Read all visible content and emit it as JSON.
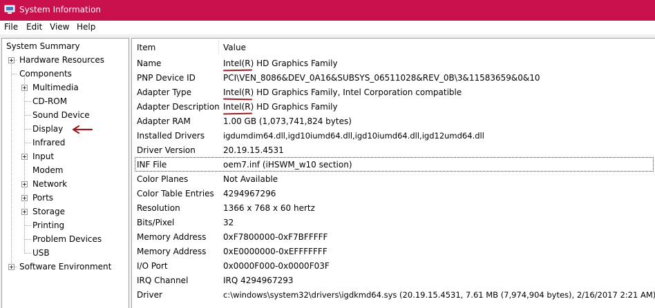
{
  "window": {
    "title": "System Information"
  },
  "menubar": {
    "items": [
      "File",
      "Edit",
      "View",
      "Help"
    ]
  },
  "tree": {
    "root": "System Summary",
    "hardware_resources": "Hardware Resources",
    "components": "Components",
    "children": [
      "Multimedia",
      "CD-ROM",
      "Sound Device",
      "Display",
      "Infrared",
      "Input",
      "Modem",
      "Network",
      "Ports",
      "Storage",
      "Printing",
      "Problem Devices",
      "USB"
    ],
    "software_environment": "Software Environment"
  },
  "table": {
    "headers": {
      "item": "Item",
      "value": "Value"
    },
    "rows": [
      {
        "item": "Name",
        "value": "Intel(R) HD Graphics Family"
      },
      {
        "item": "PNP Device ID",
        "value": "PCI\\VEN_8086&DEV_0A16&SUBSYS_06511028&REV_0B\\3&11583659&0&10"
      },
      {
        "item": "Adapter Type",
        "value": "Intel(R) HD Graphics Family, Intel Corporation compatible"
      },
      {
        "item": "Adapter Description",
        "value": "Intel(R) HD Graphics Family"
      },
      {
        "item": "Adapter RAM",
        "value": "1.00 GB (1,073,741,824 bytes)"
      },
      {
        "item": "Installed Drivers",
        "value": "igdumdim64.dll,igd10iumd64.dll,igd10iumd64.dll,igd12umd64.dll"
      },
      {
        "item": "Driver Version",
        "value": "20.19.15.4531"
      },
      {
        "item": "INF File",
        "value": "oem7.inf (iHSWM_w10 section)"
      },
      {
        "item": "Color Planes",
        "value": "Not Available"
      },
      {
        "item": "Color Table Entries",
        "value": "4294967296"
      },
      {
        "item": "Resolution",
        "value": "1366 x 768 x 60 hertz"
      },
      {
        "item": "Bits/Pixel",
        "value": "32"
      },
      {
        "item": "Memory Address",
        "value": "0xF7800000-0xF7BFFFFF"
      },
      {
        "item": "Memory Address",
        "value": "0xE0000000-0xEFFFFFFF"
      },
      {
        "item": "I/O Port",
        "value": "0x0000F000-0x0000F03F"
      },
      {
        "item": "IRQ Channel",
        "value": "IRQ 4294967293"
      },
      {
        "item": "Driver",
        "value": "c:\\windows\\system32\\drivers\\igdkmd64.sys (20.19.15.4531, 7.61 MB (7,974,904 bytes), 2/16/2017 2:21 AM)"
      }
    ]
  },
  "colors": {
    "titlebar": "#c8104d",
    "annotation": "#9b1a22"
  }
}
